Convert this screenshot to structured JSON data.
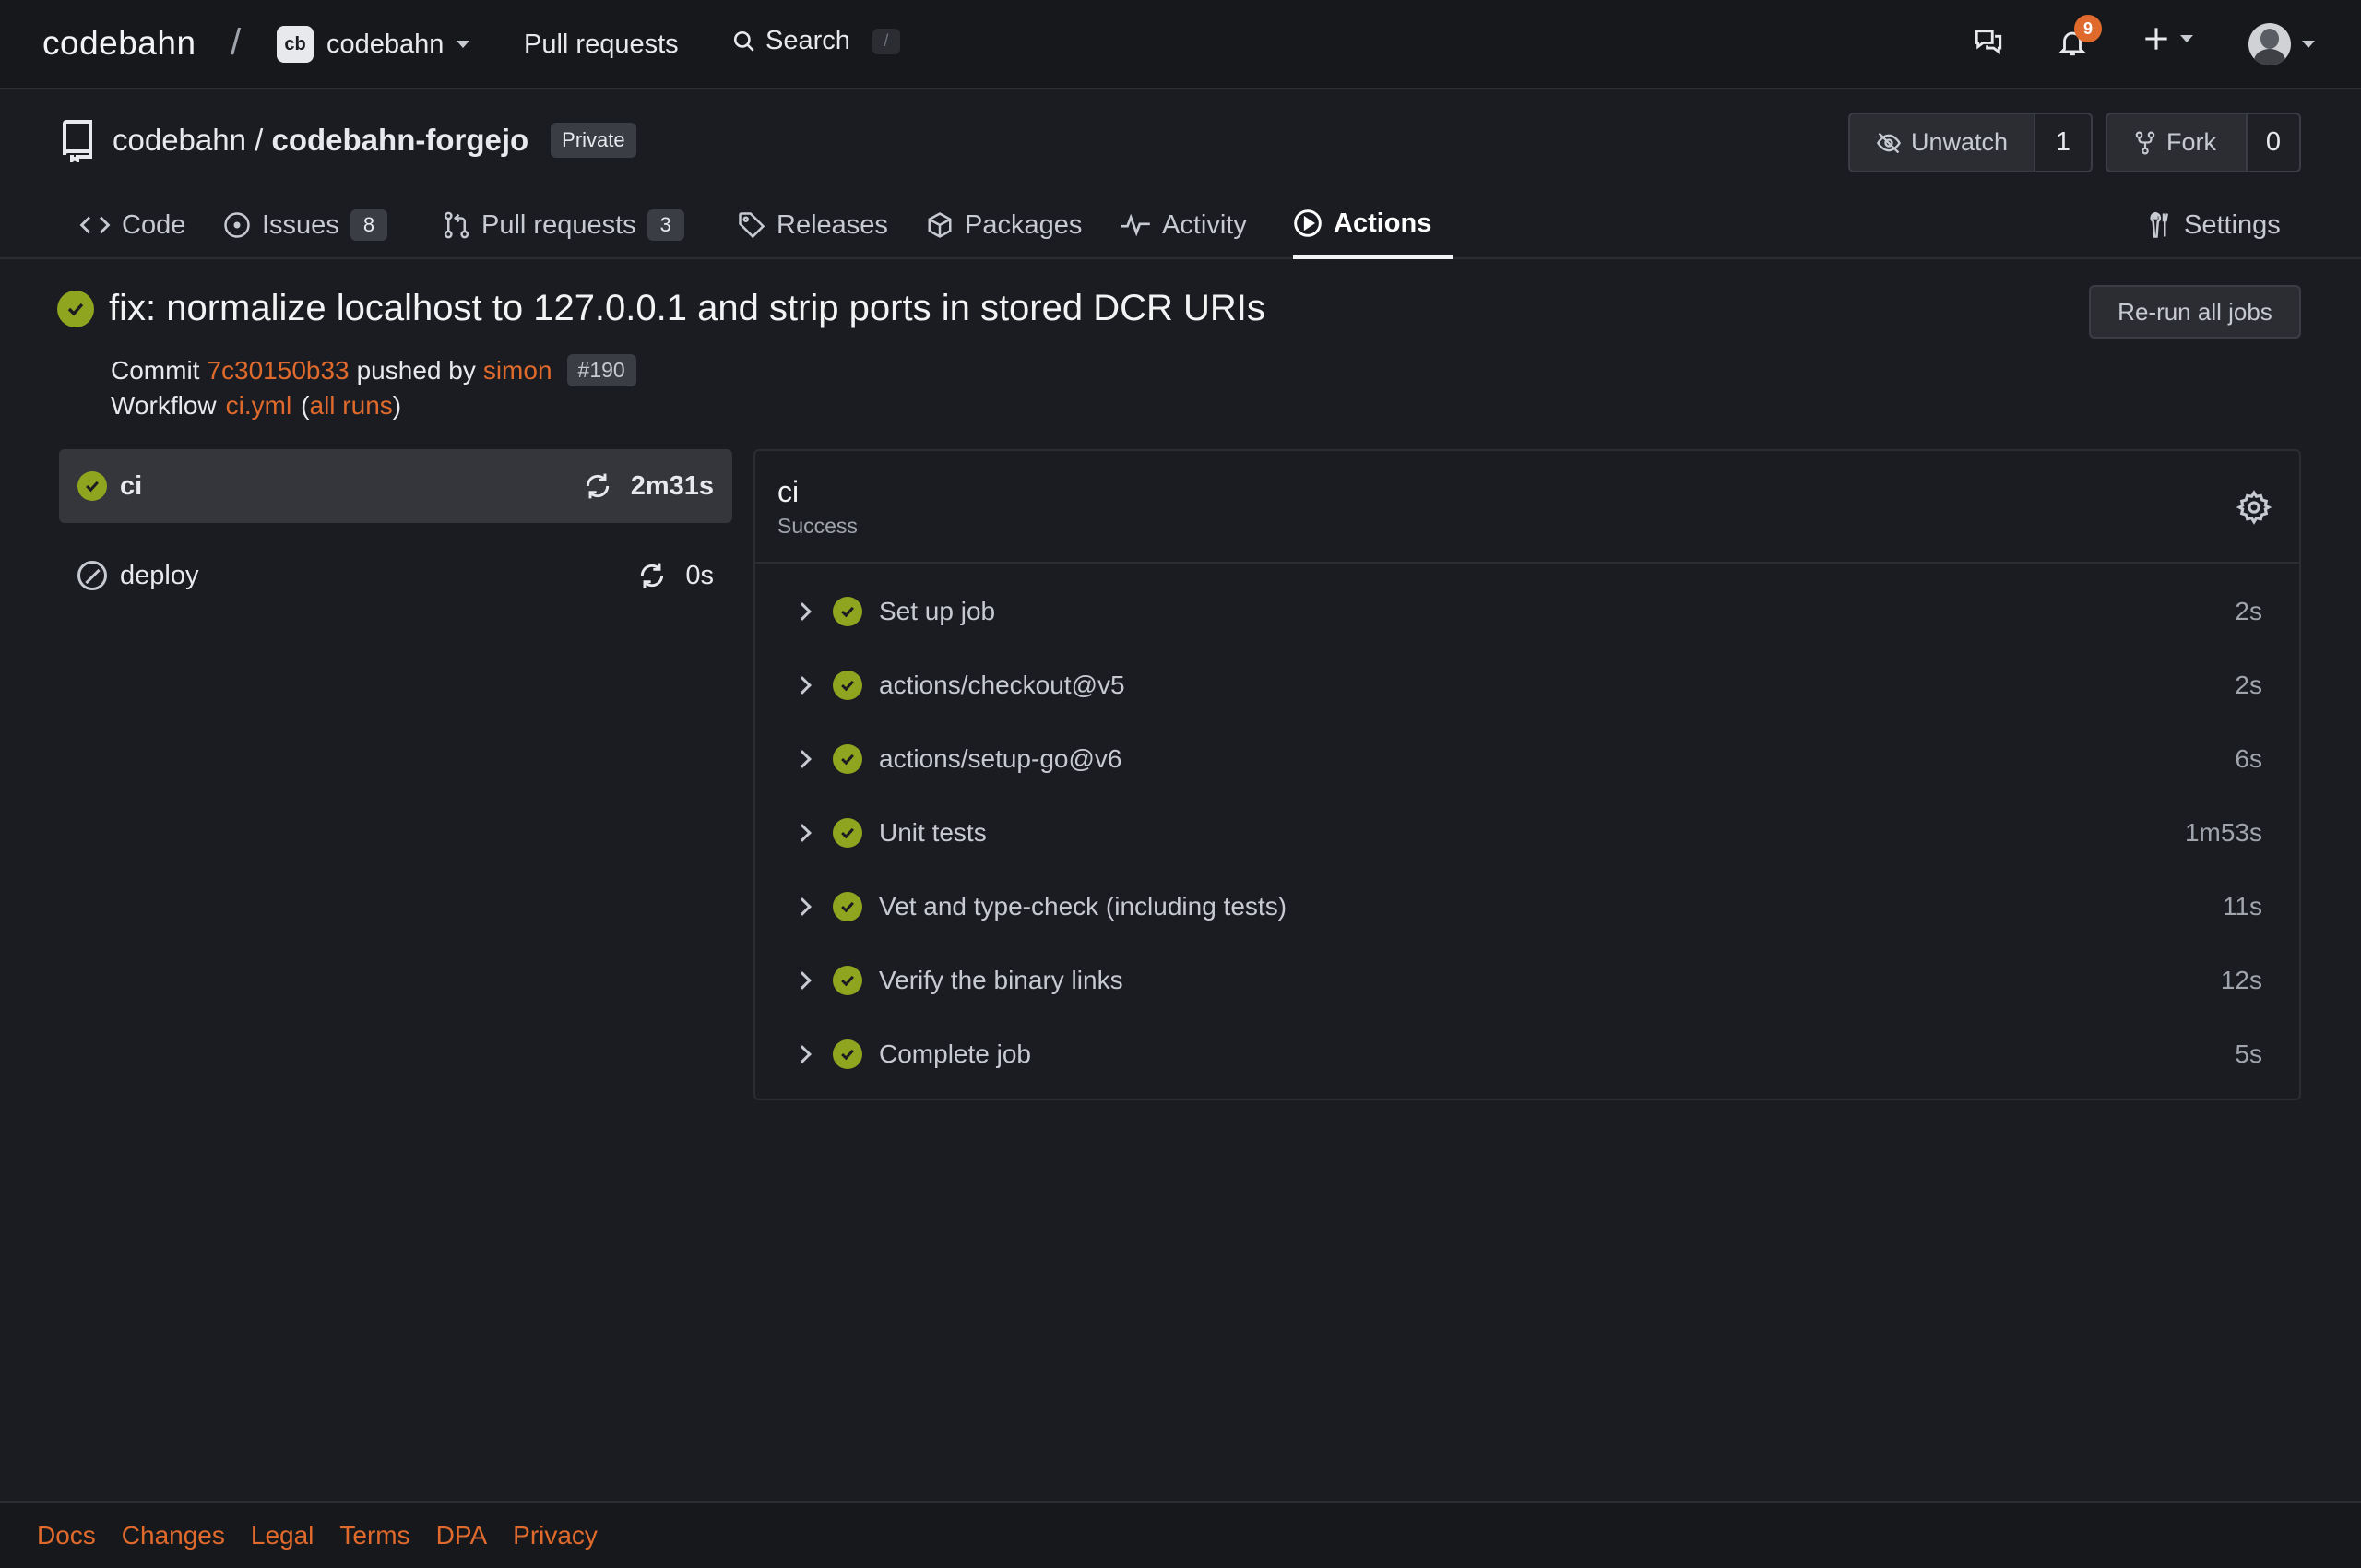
{
  "topnav": {
    "brand": "codebahn",
    "org": {
      "avatar_text": "cb",
      "name": "codebahn"
    },
    "pull_requests": "Pull requests",
    "search": {
      "label": "Search",
      "shortcut": "/"
    },
    "notifications_count": "9"
  },
  "repo": {
    "owner": "codebahn",
    "separator": "/",
    "name": "codebahn-forgejo",
    "visibility": "Private",
    "watch": {
      "label": "Unwatch",
      "count": "1"
    },
    "fork": {
      "label": "Fork",
      "count": "0"
    }
  },
  "tabs": [
    {
      "label": "Code",
      "icon": "code-icon"
    },
    {
      "label": "Issues",
      "count": "8",
      "icon": "issue-icon"
    },
    {
      "label": "Pull requests",
      "count": "3",
      "icon": "pull-request-icon"
    },
    {
      "label": "Releases",
      "icon": "tag-icon"
    },
    {
      "label": "Packages",
      "icon": "package-icon"
    },
    {
      "label": "Activity",
      "icon": "pulse-icon"
    },
    {
      "label": "Actions",
      "icon": "play-icon",
      "active": true
    },
    {
      "label": "Settings",
      "icon": "tools-icon"
    }
  ],
  "run": {
    "title": "fix: normalize localhost to 127.0.0.1 and strip ports in stored DCR URIs",
    "rerun_label": "Re-run all jobs",
    "commit_prefix": "Commit",
    "commit_sha": "7c30150b33",
    "pushed_by_text": "pushed by",
    "author": "simon",
    "run_number": "#190",
    "workflow_prefix": "Workflow",
    "workflow_file": "ci.yml",
    "paren_open": "(",
    "all_runs": "all runs",
    "paren_close": ")"
  },
  "jobs": [
    {
      "name": "ci",
      "duration": "2m31s",
      "status": "success"
    },
    {
      "name": "deploy",
      "duration": "0s",
      "status": "skipped"
    }
  ],
  "detail": {
    "title": "ci",
    "status": "Success",
    "steps": [
      {
        "name": "Set up job",
        "duration": "2s"
      },
      {
        "name": "actions/checkout@v5",
        "duration": "2s"
      },
      {
        "name": "actions/setup-go@v6",
        "duration": "6s"
      },
      {
        "name": "Unit tests",
        "duration": "1m53s"
      },
      {
        "name": "Vet and type-check (including tests)",
        "duration": "11s"
      },
      {
        "name": "Verify the binary links",
        "duration": "12s"
      },
      {
        "name": "Complete job",
        "duration": "5s"
      }
    ]
  },
  "footer": {
    "links": [
      "Docs",
      "Changes",
      "Legal",
      "Terms",
      "DPA",
      "Privacy"
    ]
  },
  "colors": {
    "accent": "#e06a2c",
    "success": "#8fa51f",
    "background": "#1b1c21"
  }
}
